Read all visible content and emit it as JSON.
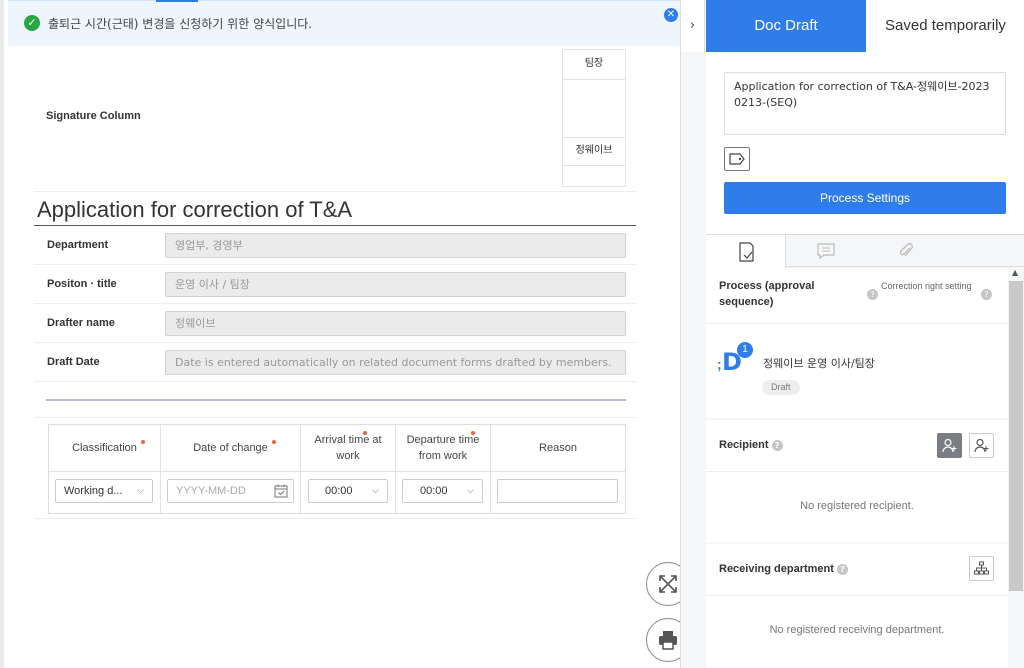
{
  "banner": {
    "message": "출퇴근 시간(근태) 변경을 신청하기 위한 양식입니다."
  },
  "signature": {
    "label": "Signature Column",
    "role": "팀장",
    "name": "정웨이브"
  },
  "document": {
    "title": "Application for correction of T&A",
    "fields": [
      {
        "label": "Department",
        "value": "영업부, 경영부"
      },
      {
        "label": "Positon · title",
        "value": "운영 이사 / 팀장"
      },
      {
        "label": "Drafter name",
        "value": "정웨이브"
      },
      {
        "label": "Draft Date",
        "value": "Date is entered automatically on related document forms drafted by members."
      }
    ],
    "table": {
      "headers": [
        "Classification",
        "Date of change",
        "Arrival time at work",
        "Departure time from work",
        "Reason"
      ],
      "row": {
        "classification": "Working d...",
        "date_placeholder": "YYYY-MM-DD",
        "arrival": "00:00",
        "departure": "00:00",
        "reason": ""
      }
    }
  },
  "panel": {
    "tabs": {
      "draft": "Doc Draft",
      "saved": "Saved temporarily"
    },
    "doc_title": "Application for correction of T&A-정웨이브-20230213-(SEQ)",
    "process_button": "Process Settings",
    "process": {
      "heading": "Process (approval sequence)",
      "correction": "Correction right setting",
      "approver_name": "정웨이브 운영 이사/팀장",
      "approver_status": "Draft",
      "badge_count": "1",
      "avatar_letter": "D"
    },
    "recipient": {
      "heading": "Recipient",
      "empty": "No registered recipient."
    },
    "receiving": {
      "heading": "Receiving department",
      "empty": "No registered receiving department."
    }
  },
  "colors": {
    "accent": "#2f7dea",
    "required_dot": "#e8683d",
    "success": "#29a745"
  }
}
